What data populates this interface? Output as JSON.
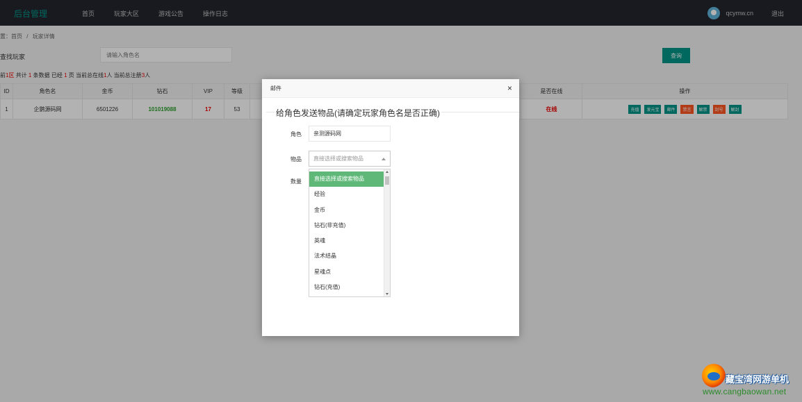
{
  "topbar": {
    "brand": "后台管理",
    "nav": [
      "首页",
      "玩家大区",
      "游戏公告",
      "操作日志"
    ],
    "user_name": "qcymw.cn",
    "logout": "退出"
  },
  "breadcrumb": [
    "置：首页",
    "/",
    "玩家详情"
  ],
  "search": {
    "label": "查找玩家",
    "placeholder": "请输入角色名",
    "button": "查询"
  },
  "stats": {
    "prefix": "前",
    "zone": "1区",
    "total_label": "共计",
    "total": "1",
    "unit": "条数据 已经",
    "page": "1",
    "page_suffix": "页 当前总在线",
    "online": "1",
    "online_suffix": "人 当前总注册",
    "registered": "3",
    "registered_suffix": "人"
  },
  "table": {
    "headers": [
      "ID",
      "角色名",
      "金币",
      "钻石",
      "VIP",
      "等级",
      "是否在线",
      "操作"
    ],
    "row": {
      "id": "1",
      "name": "企鹅源码网",
      "gold": "6501226",
      "diamond": "101019088",
      "vip": "17",
      "level": "53",
      "online": "在线"
    },
    "actions": [
      {
        "label": "充值",
        "color": "#009688"
      },
      {
        "label": "发元宝",
        "color": "#009688"
      },
      {
        "label": "邮件",
        "color": "#009688"
      },
      {
        "label": "禁言",
        "color": "#ff5722"
      },
      {
        "label": "解禁",
        "color": "#009688"
      },
      {
        "label": "封号",
        "color": "#ff5722"
      },
      {
        "label": "解封",
        "color": "#009688"
      }
    ]
  },
  "modal": {
    "title": "邮件",
    "close": "×",
    "legend": "给角色发送物品(请确定玩家角色名是否正确)",
    "role_label": "角色",
    "role_value": "亲测源码网",
    "item_label": "物品",
    "item_placeholder": "直接选择或搜索物品",
    "qty_label": "数量",
    "options": [
      "直接选择或搜索物品",
      "经验",
      "金币",
      "钻石(非充值)",
      "英魂",
      "法术结晶",
      "星魂点",
      "钻石(充值)"
    ]
  },
  "watermark": {
    "title": "藏宝湾网游单机",
    "url": "www.cangbaowan.net"
  }
}
